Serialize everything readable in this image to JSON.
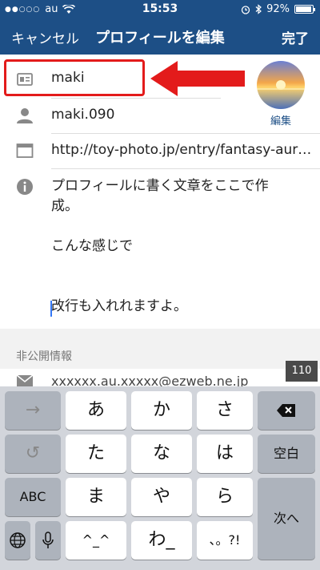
{
  "status_bar": {
    "signal": "●●○○○",
    "carrier": "au",
    "time": "15:53",
    "battery": "92%"
  },
  "nav": {
    "cancel_label": "キャンセル",
    "title": "プロフィールを編集",
    "done_label": "完了"
  },
  "profile": {
    "name": "maki",
    "username": "maki.090",
    "website": "http://toy-photo.jp/entry/fantasy-aur…",
    "avatar_edit_label": "編集",
    "bio_lines": [
      "プロフィールに書く文章をここで作",
      "成。",
      "",
      "こんな感じで",
      "",
      "",
      "改行も入れれますよ。"
    ],
    "char_counter": "110"
  },
  "private_section": {
    "header": "非公開情報",
    "email": "xxxxxx.au.xxxxx@ezweb.ne.jp"
  },
  "keyboard": {
    "row1": [
      "→",
      "あ",
      "か",
      "さ",
      "⌫"
    ],
    "row2": [
      "↺",
      "た",
      "な",
      "は",
      "空白"
    ],
    "row3": [
      "ABC",
      "ま",
      "や",
      "ら",
      "次へ"
    ],
    "row4": [
      "🌐",
      "🎤",
      "^_^",
      "わ_",
      "、。?!"
    ]
  },
  "colors": {
    "nav_background": "#1d4f86",
    "highlight": "#e31b1b",
    "accent": "#3478f6"
  }
}
